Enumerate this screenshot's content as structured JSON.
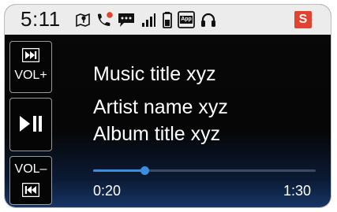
{
  "status_bar": {
    "time": "5:11",
    "icons": [
      "location-pin-icon",
      "missed-call-icon",
      "message-icon",
      "signal-bars-icon",
      "battery-icon",
      "app-icon",
      "headphones-icon",
      "s-badge"
    ],
    "app_icon_label": "App",
    "badge_text": "S",
    "badge_color": "#e0432f"
  },
  "controls": {
    "vol_up_label": "VOL+",
    "vol_down_label": "VOL–",
    "skip_forward_icon": "skip-forward-icon",
    "play_pause_icon": "play-pause-icon",
    "skip_back_icon": "skip-back-icon"
  },
  "track": {
    "music_title": "Music title xyz",
    "artist_name": "Artist name xyz",
    "album_title": "Album title xyz"
  },
  "progress": {
    "current": "0:20",
    "total": "1:30",
    "fraction": 0.23,
    "accent_color": "#3d8dde"
  }
}
